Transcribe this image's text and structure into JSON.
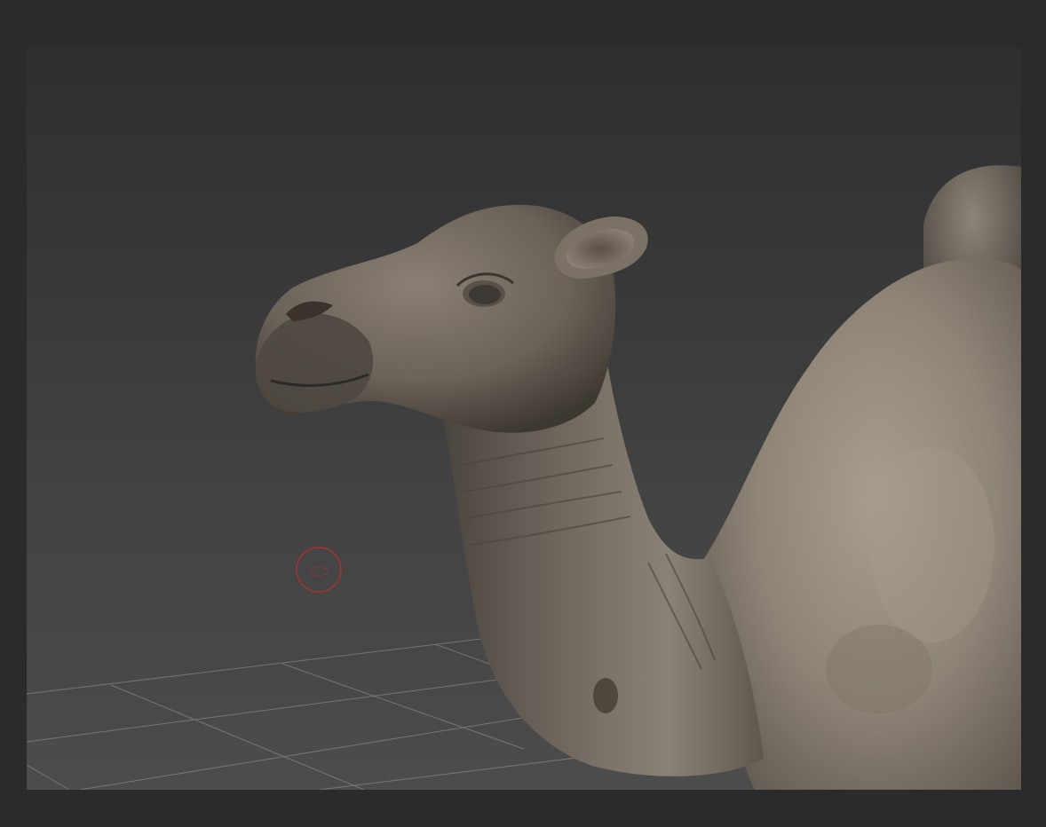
{
  "app": {
    "theme": {
      "frame_color": "#2b2b2b",
      "viewport_top_color": "#2f2f2f",
      "viewport_bottom_color": "#4b4b4b",
      "grid_line_color": "#9a9a9a",
      "cursor_color": "#a83232"
    }
  },
  "viewport": {
    "subject": "camel-sculpt-icon",
    "floor_grid": "grid-icon",
    "brush_cursor": "brush-cursor-icon"
  }
}
